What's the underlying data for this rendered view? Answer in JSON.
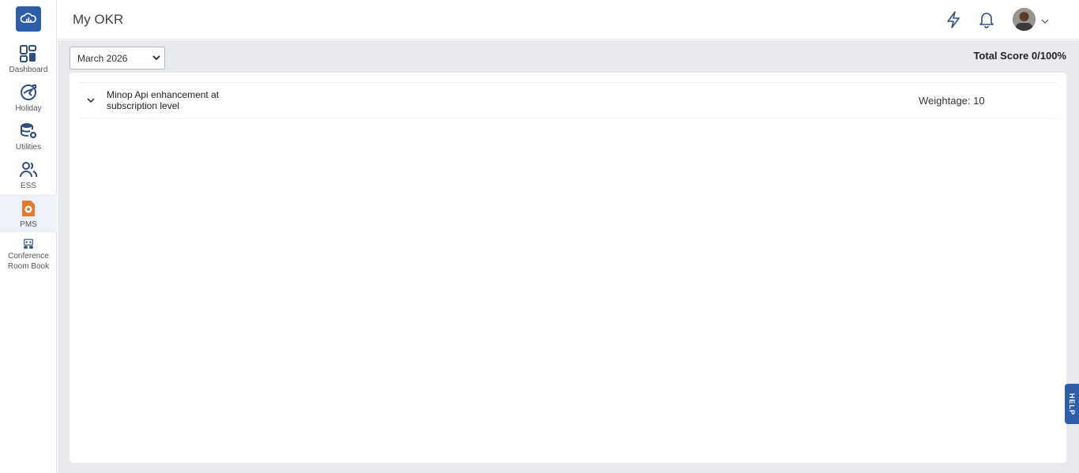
{
  "sidebar": {
    "items": [
      {
        "label": "Dashboard",
        "icon": "dashboard-icon"
      },
      {
        "label": "Holiday",
        "icon": "holiday-icon"
      },
      {
        "label": "Utilities",
        "icon": "utilities-icon"
      },
      {
        "label": "ESS",
        "icon": "ess-icon"
      },
      {
        "label": "PMS",
        "icon": "pms-icon",
        "active": true
      },
      {
        "label": "Conference Room Book",
        "icon": "conference-room-icon"
      }
    ],
    "logo_icon": "cloud-logo-icon"
  },
  "header": {
    "title": "My OKR",
    "icons": [
      "lightning-icon",
      "bell-icon",
      "avatar",
      "chevron-down-icon"
    ]
  },
  "main": {
    "month_select": {
      "value": "March 2026"
    },
    "total_score": "Total Score 0/100%",
    "okrs": [
      {
        "title": "Minop Api enhancement at subscription level",
        "weightage": "Weightage: 10"
      }
    ]
  },
  "help": {
    "label": "HELP"
  },
  "colors": {
    "accent": "#2f5ea8",
    "active_icon": "#e07b2e",
    "background": "#e8eaed"
  }
}
